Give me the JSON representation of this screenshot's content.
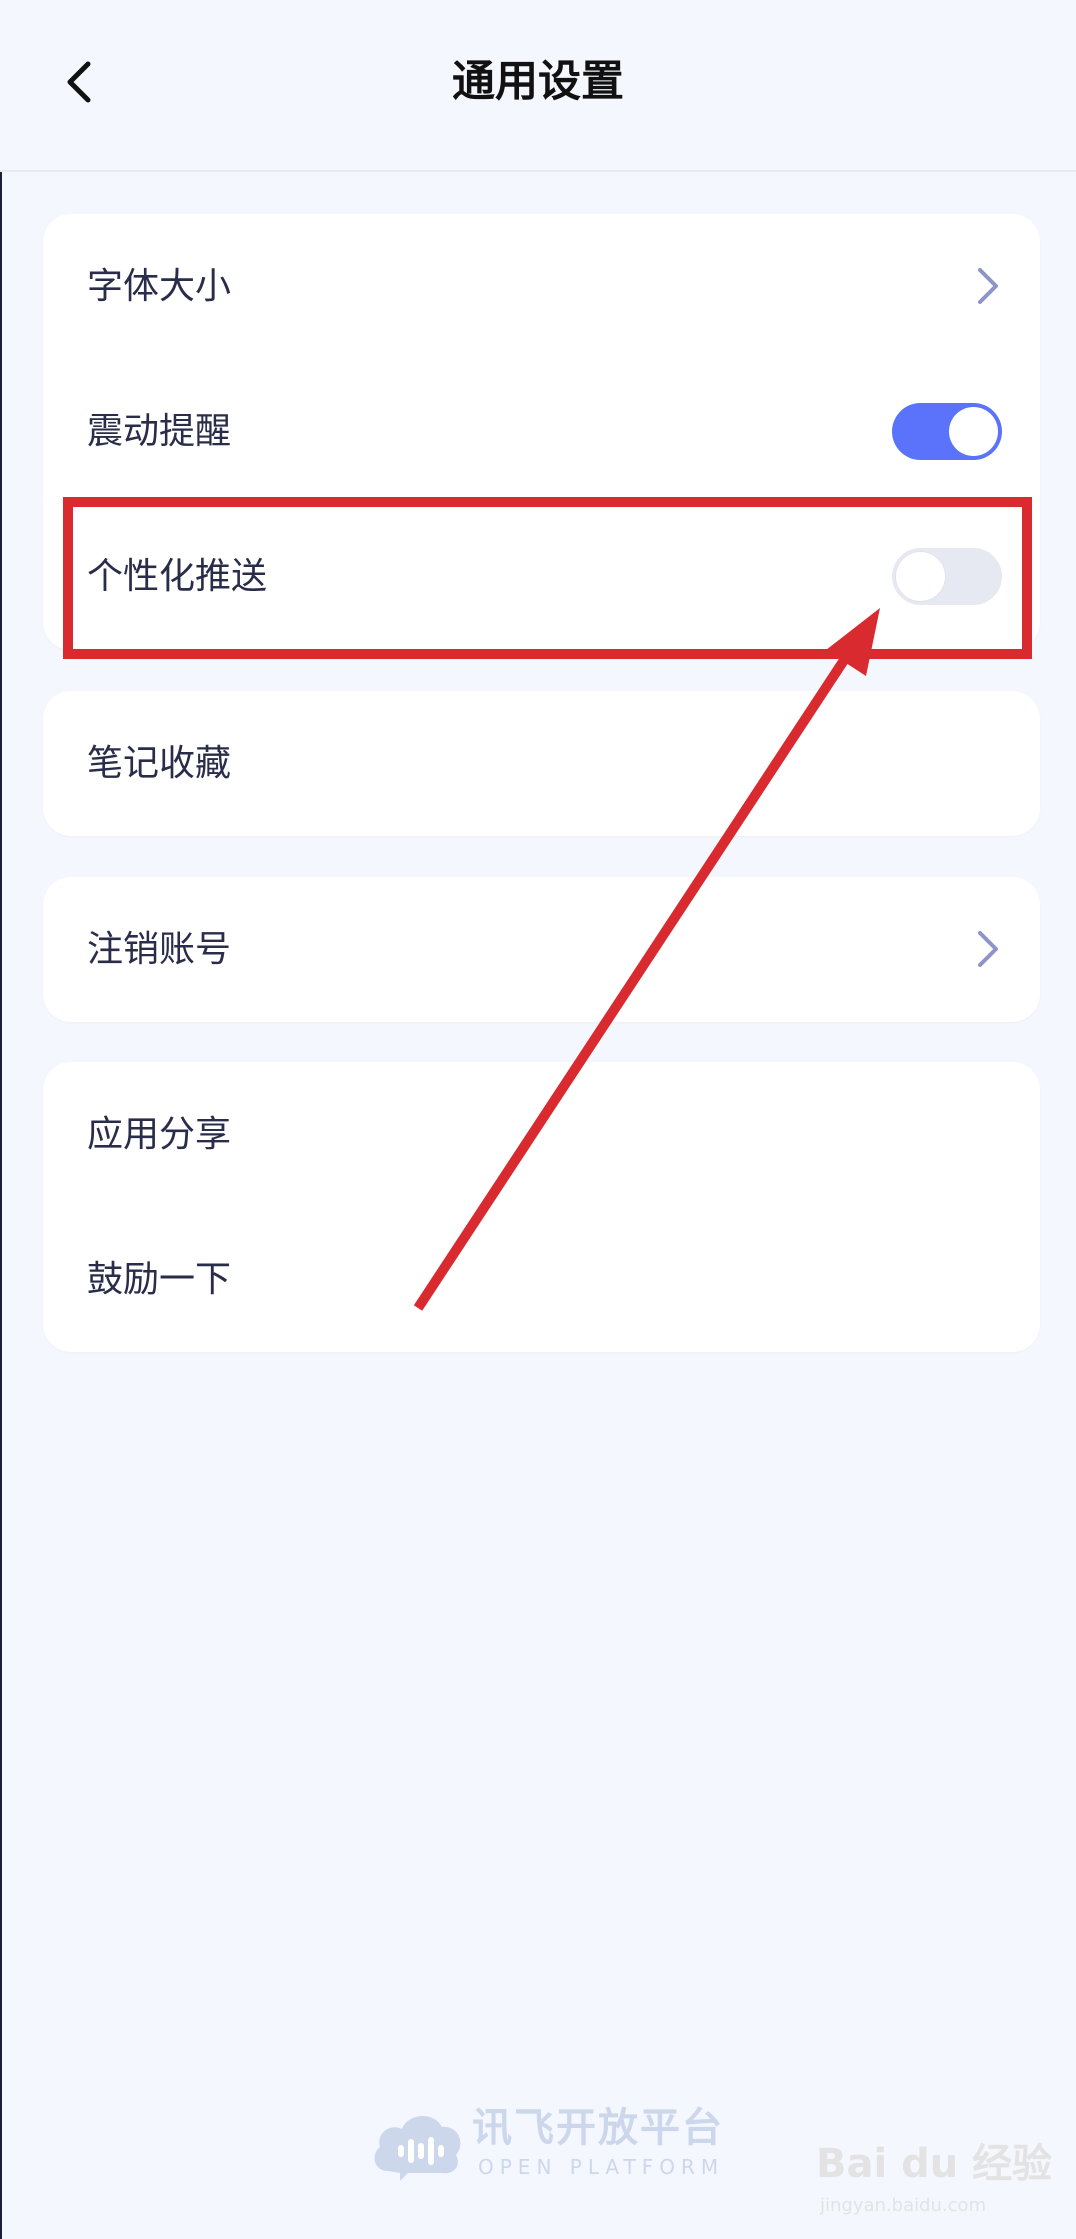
{
  "header": {
    "title": "通用设置",
    "back_icon": "chevron-left-icon"
  },
  "groups": [
    {
      "items": [
        {
          "label": "字体大小",
          "control": "chevron"
        },
        {
          "label": "震动提醒",
          "control": "toggle",
          "enabled": true
        },
        {
          "label": "个性化推送",
          "control": "toggle",
          "enabled": false
        }
      ]
    },
    {
      "items": [
        {
          "label": "笔记收藏",
          "control": "none"
        }
      ]
    },
    {
      "items": [
        {
          "label": "注销账号",
          "control": "chevron"
        }
      ]
    },
    {
      "items": [
        {
          "label": "应用分享",
          "control": "none"
        },
        {
          "label": "鼓励一下",
          "control": "none"
        }
      ]
    }
  ],
  "footer": {
    "logo_title": "讯飞开放平台",
    "logo_subtitle": "OPEN PLATFORM"
  },
  "watermark": {
    "main": "Bai du 经验",
    "sub": "jingyan.baidu.com"
  },
  "colors": {
    "accent": "#5b73fb",
    "annotation": "#d92a2f",
    "background": "#f4f7fd"
  }
}
